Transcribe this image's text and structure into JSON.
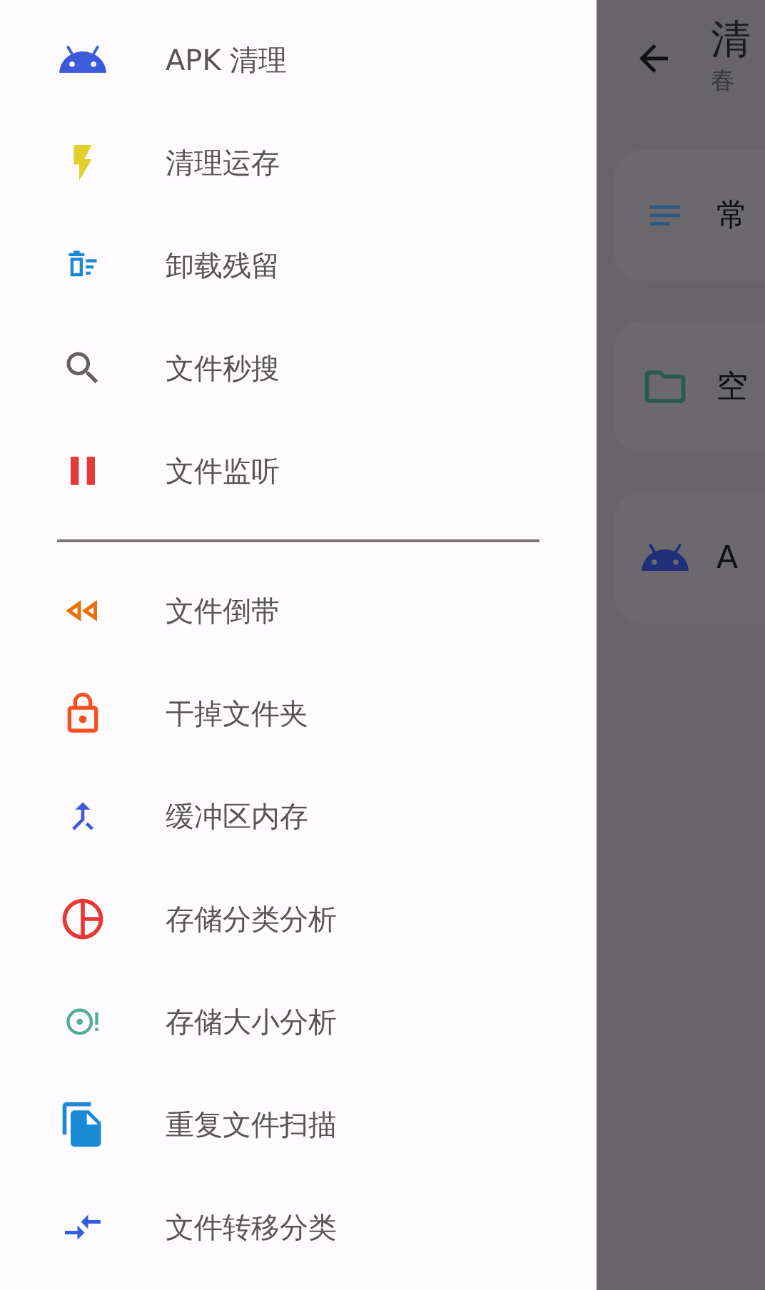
{
  "drawer": {
    "groups": [
      {
        "items": [
          {
            "label": "APK 清理"
          },
          {
            "label": "清理运存"
          },
          {
            "label": "卸载残留"
          },
          {
            "label": "文件秒搜"
          },
          {
            "label": "文件监听"
          }
        ]
      },
      {
        "items": [
          {
            "label": "文件倒带"
          },
          {
            "label": "干掉文件夹"
          },
          {
            "label": "缓冲区内存"
          },
          {
            "label": "存储分类分析"
          },
          {
            "label": "存储大小分析"
          },
          {
            "label": "重复文件扫描"
          },
          {
            "label": "文件转移分类"
          }
        ]
      }
    ]
  },
  "background_screen": {
    "title": "清",
    "subtitle": "春",
    "cards": [
      {
        "label": "常"
      },
      {
        "label": "空"
      },
      {
        "label": "A"
      }
    ]
  }
}
